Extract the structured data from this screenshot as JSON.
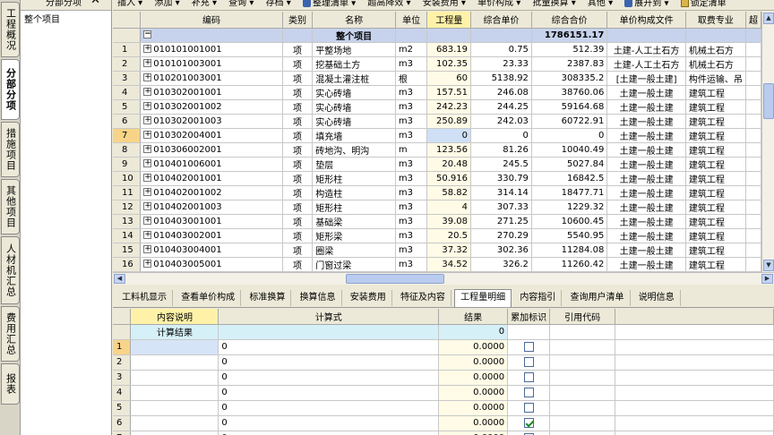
{
  "left_tabs": [
    {
      "label": "工程概况",
      "active": false
    },
    {
      "label": "分部分项",
      "active": true
    },
    {
      "label": "措施项目",
      "active": false
    },
    {
      "label": "其他项目",
      "active": false
    },
    {
      "label": "人材机汇总",
      "active": false
    },
    {
      "label": "费用汇总",
      "active": false
    },
    {
      "label": "报表",
      "active": false
    }
  ],
  "tree_panel": {
    "title": "分部分项",
    "close_label": "✕",
    "root_item": "整个项目"
  },
  "toolbar": {
    "items": [
      "插入 ▾",
      "添加 ▾",
      "补充 ▾",
      "查询 ▾",
      "存档 ▾",
      "整理清单 ▾",
      "超高降效 ▾",
      "安装费用 ▾",
      "单价构成 ▾",
      "批量换算 ▾",
      "其他 ▾",
      "展开到 ▾",
      "锁定清单"
    ]
  },
  "main_table": {
    "columns": [
      "",
      "编码",
      "类别",
      "名称",
      "单位",
      "工程量",
      "综合单价",
      "综合合价",
      "单价构成文件",
      "取费专业",
      "超"
    ],
    "total_row": {
      "expander": "−",
      "name": "整个项目",
      "total": "1786151.17"
    },
    "rows": [
      {
        "no": "1",
        "code": "010101001001",
        "type": "项",
        "name": "平整场地",
        "unit": "m2",
        "qty": "683.19",
        "price": "0.75",
        "amount": "512.39",
        "file": "土建-人工土石方",
        "major": "机械土石方",
        "sel": false
      },
      {
        "no": "2",
        "code": "010101003001",
        "type": "项",
        "name": "挖基础土方",
        "unit": "m3",
        "qty": "102.35",
        "price": "23.33",
        "amount": "2387.83",
        "file": "土建-人工土石方",
        "major": "机械土石方",
        "sel": false
      },
      {
        "no": "3",
        "code": "010201003001",
        "type": "项",
        "name": "混凝土灌注桩",
        "unit": "根",
        "qty": "60",
        "price": "5138.92",
        "amount": "308335.2",
        "file": "[土建一般土建]",
        "major": "构件运输、吊",
        "sel": false
      },
      {
        "no": "4",
        "code": "010302001001",
        "type": "项",
        "name": "实心砖墙",
        "unit": "m3",
        "qty": "157.51",
        "price": "246.08",
        "amount": "38760.06",
        "file": "土建一般土建",
        "major": "建筑工程",
        "sel": false
      },
      {
        "no": "5",
        "code": "010302001002",
        "type": "项",
        "name": "实心砖墙",
        "unit": "m3",
        "qty": "242.23",
        "price": "244.25",
        "amount": "59164.68",
        "file": "土建一般土建",
        "major": "建筑工程",
        "sel": false
      },
      {
        "no": "6",
        "code": "010302001003",
        "type": "项",
        "name": "实心砖墙",
        "unit": "m3",
        "qty": "250.89",
        "price": "242.03",
        "amount": "60722.91",
        "file": "土建一般土建",
        "major": "建筑工程",
        "sel": false
      },
      {
        "no": "7",
        "code": "010302004001",
        "type": "项",
        "name": "填充墙",
        "unit": "m3",
        "qty": "0",
        "price": "0",
        "amount": "0",
        "file": "土建一般土建",
        "major": "建筑工程",
        "sel": true
      },
      {
        "no": "8",
        "code": "010306002001",
        "type": "项",
        "name": "砖地沟、明沟",
        "unit": "m",
        "qty": "123.56",
        "price": "81.26",
        "amount": "10040.49",
        "file": "土建一般土建",
        "major": "建筑工程",
        "sel": false
      },
      {
        "no": "9",
        "code": "010401006001",
        "type": "项",
        "name": "垫层",
        "unit": "m3",
        "qty": "20.48",
        "price": "245.5",
        "amount": "5027.84",
        "file": "土建一般土建",
        "major": "建筑工程",
        "sel": false
      },
      {
        "no": "10",
        "code": "010402001001",
        "type": "项",
        "name": "矩形柱",
        "unit": "m3",
        "qty": "50.916",
        "price": "330.79",
        "amount": "16842.5",
        "file": "土建一般土建",
        "major": "建筑工程",
        "sel": false
      },
      {
        "no": "11",
        "code": "010402001002",
        "type": "项",
        "name": "构造柱",
        "unit": "m3",
        "qty": "58.82",
        "price": "314.14",
        "amount": "18477.71",
        "file": "土建一般土建",
        "major": "建筑工程",
        "sel": false
      },
      {
        "no": "12",
        "code": "010402001003",
        "type": "项",
        "name": "矩形柱",
        "unit": "m3",
        "qty": "4",
        "price": "307.33",
        "amount": "1229.32",
        "file": "土建一般土建",
        "major": "建筑工程",
        "sel": false
      },
      {
        "no": "13",
        "code": "010403001001",
        "type": "项",
        "name": "基础梁",
        "unit": "m3",
        "qty": "39.08",
        "price": "271.25",
        "amount": "10600.45",
        "file": "土建一般土建",
        "major": "建筑工程",
        "sel": false
      },
      {
        "no": "14",
        "code": "010403002001",
        "type": "项",
        "name": "矩形梁",
        "unit": "m3",
        "qty": "20.5",
        "price": "270.29",
        "amount": "5540.95",
        "file": "土建一般土建",
        "major": "建筑工程",
        "sel": false
      },
      {
        "no": "15",
        "code": "010403004001",
        "type": "项",
        "name": "圈梁",
        "unit": "m3",
        "qty": "37.32",
        "price": "302.36",
        "amount": "11284.08",
        "file": "土建一般土建",
        "major": "建筑工程",
        "sel": false
      },
      {
        "no": "16",
        "code": "010403005001",
        "type": "项",
        "name": "门窗过梁",
        "unit": "m3",
        "qty": "34.52",
        "price": "326.2",
        "amount": "11260.42",
        "file": "土建一般土建",
        "major": "建筑工程",
        "sel": false
      }
    ]
  },
  "bottom_tabs": [
    {
      "label": "工料机显示",
      "active": false
    },
    {
      "label": "查看单价构成",
      "active": false
    },
    {
      "label": "标准换算",
      "active": false
    },
    {
      "label": "换算信息",
      "active": false
    },
    {
      "label": "安装费用",
      "active": false
    },
    {
      "label": "特征及内容",
      "active": false
    },
    {
      "label": "工程量明细",
      "active": true
    },
    {
      "label": "内容指引",
      "active": false
    },
    {
      "label": "查询用户清单",
      "active": false
    },
    {
      "label": "说明信息",
      "active": false
    }
  ],
  "sub_table": {
    "columns": [
      "",
      "内容说明",
      "计算式",
      "结果",
      "累加标识",
      "引用代码"
    ],
    "result_row": {
      "desc": "计算结果",
      "value": "0"
    },
    "rows": [
      {
        "no": "1",
        "formula": "0",
        "result": "0.0000",
        "checked": false,
        "sel": true
      },
      {
        "no": "2",
        "formula": "0",
        "result": "0.0000",
        "checked": false,
        "sel": false
      },
      {
        "no": "3",
        "formula": "0",
        "result": "0.0000",
        "checked": false,
        "sel": false
      },
      {
        "no": "4",
        "formula": "0",
        "result": "0.0000",
        "checked": false,
        "sel": false
      },
      {
        "no": "5",
        "formula": "0",
        "result": "0.0000",
        "checked": false,
        "sel": false
      },
      {
        "no": "6",
        "formula": "0",
        "result": "0.0000",
        "checked": true,
        "sel": false
      },
      {
        "no": "7",
        "formula": "0",
        "result": "0.0000",
        "checked": true,
        "sel": false
      }
    ]
  }
}
